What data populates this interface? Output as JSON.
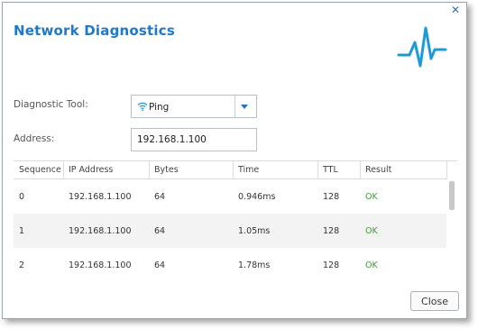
{
  "dialog": {
    "title": "Network Diagnostics",
    "close_icon": "close-icon",
    "header_icon": "pulse-icon"
  },
  "form": {
    "tool_label": "Diagnostic Tool:",
    "tool_value": "Ping",
    "tool_icon": "wifi-icon",
    "address_label": "Address:",
    "address_value": "192.168.1.100"
  },
  "table": {
    "columns": [
      "Sequence",
      "IP Address",
      "Bytes",
      "Time",
      "TTL",
      "Result"
    ],
    "rows": [
      {
        "sequence": "0",
        "ip": "192.168.1.100",
        "bytes": "64",
        "time": "0.946ms",
        "ttl": "128",
        "result": "OK"
      },
      {
        "sequence": "1",
        "ip": "192.168.1.100",
        "bytes": "64",
        "time": "1.05ms",
        "ttl": "128",
        "result": "OK"
      },
      {
        "sequence": "2",
        "ip": "192.168.1.100",
        "bytes": "64",
        "time": "1.78ms",
        "ttl": "128",
        "result": "OK"
      }
    ]
  },
  "footer": {
    "close_label": "Close"
  },
  "colors": {
    "accent": "#1f78c8",
    "ok": "#3a9d2f"
  }
}
